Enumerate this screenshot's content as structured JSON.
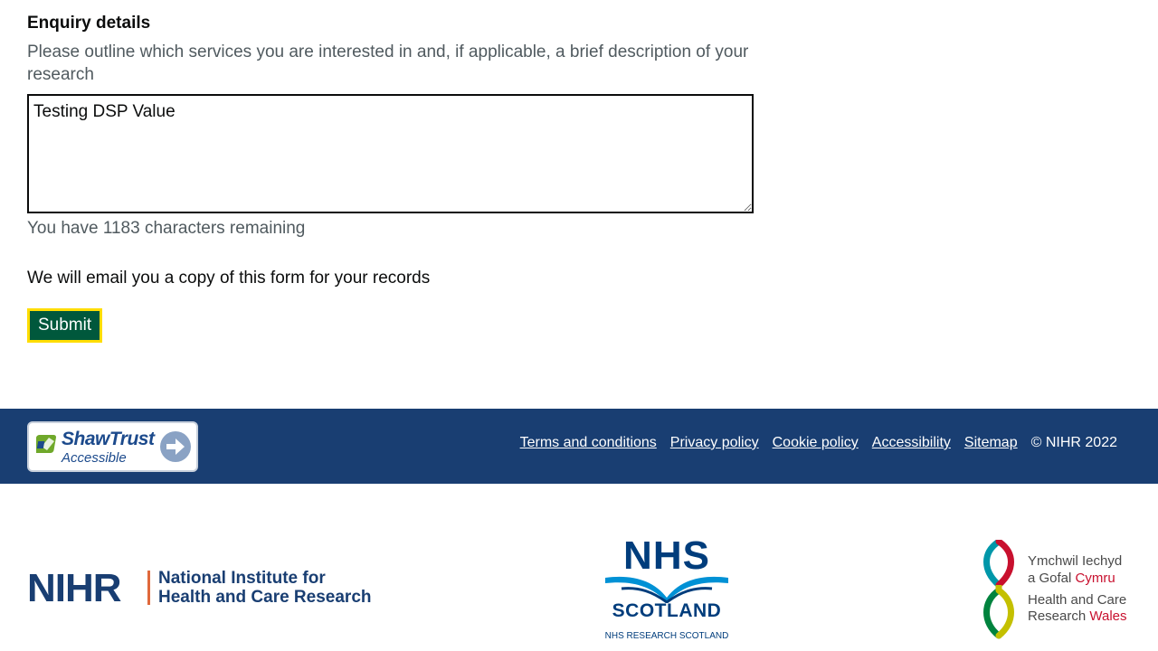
{
  "form": {
    "title": "Enquiry details",
    "hint": "Please outline which services you are interested in and, if applicable, a brief description of your research",
    "textarea_value": "Testing DSP Value",
    "char_count_text": "You have 1183 characters remaining",
    "email_note": "We will email you a copy of this form for your records",
    "submit_label": "Submit"
  },
  "footer": {
    "badge": {
      "name": "ShawTrust",
      "sub": "Accessible",
      "icon": "arrow-right-icon"
    },
    "links": [
      {
        "label": "Terms and conditions"
      },
      {
        "label": "Privacy policy"
      },
      {
        "label": "Cookie policy"
      },
      {
        "label": "Accessibility"
      },
      {
        "label": "Sitemap"
      }
    ],
    "copyright": "© NIHR 2022",
    "background_color": "#193e72"
  },
  "logos": {
    "nihr": {
      "mark": "NIHR",
      "line1": "National Institute for",
      "line2": "Health and Care Research"
    },
    "nhs_scotland": {
      "mark": "NHS",
      "name": "SCOTLAND",
      "sub": "NHS RESEARCH SCOTLAND"
    },
    "hcrw": {
      "line1": "Ymchwil Iechyd",
      "line2_a": "a Gofal ",
      "line2_b": "Cymru",
      "line3": "Health and Care",
      "line4_a": "Research ",
      "line4_b": "Wales"
    }
  },
  "colors": {
    "submit_bg": "#00583c",
    "focus_ring": "#ffdd00",
    "hint_text": "#505a5f"
  }
}
